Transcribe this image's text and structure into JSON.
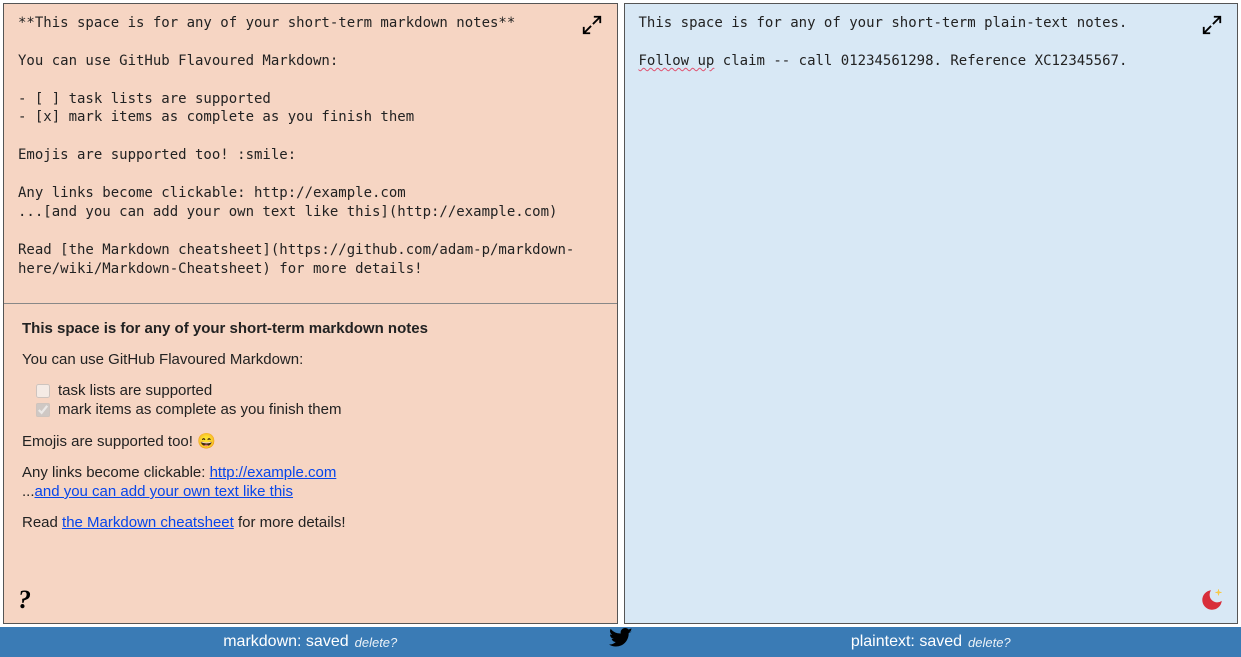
{
  "markdown": {
    "raw": "**This space is for any of your short-term markdown notes**\n\nYou can use GitHub Flavoured Markdown:\n\n- [ ] task lists are supported\n- [x] mark items as complete as you finish them\n\nEmojis are supported too! :smile:\n\nAny links become clickable: http://example.com\n...[and you can add your own text like this](http://example.com)\n\nRead [the Markdown cheatsheet](https://github.com/adam-p/markdown-here/wiki/Markdown-Cheatsheet) for more details!",
    "preview": {
      "title": "This space is for any of your short-term markdown notes",
      "line_gfm": "You can use GitHub Flavoured Markdown:",
      "task1": "task lists are supported",
      "task2": "mark items as complete as you finish them",
      "emoji_line_pre": "Emojis are supported too! ",
      "emoji": "😄",
      "links_pre": "Any links become clickable: ",
      "link1_text": "http://example.com",
      "links2_pre": "...",
      "link2_text": "and you can add your own text like this",
      "read_pre": "Read ",
      "cheatsheet_text": "the Markdown cheatsheet",
      "read_post": " for more details!"
    }
  },
  "plaintext": {
    "line1": "This space is for any of your short-term plain-text notes.",
    "followup_word": "Follow up",
    "followup_rest": " claim -- call 01234561298. Reference XC12345567."
  },
  "footer": {
    "left_status": "markdown: saved",
    "right_status": "plaintext: saved",
    "delete": "delete?"
  }
}
